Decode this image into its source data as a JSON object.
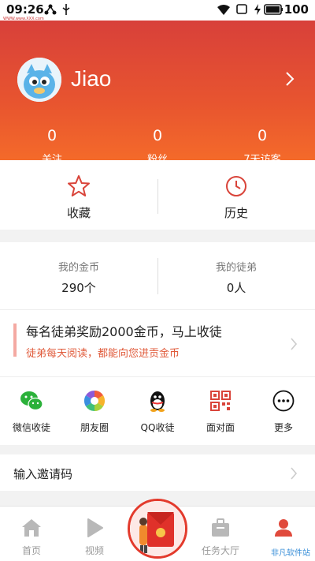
{
  "status_bar": {
    "time": "09:26",
    "battery": "100",
    "tiny_text": "WWW.www.XXX.com"
  },
  "profile": {
    "username": "Jiao"
  },
  "stats": [
    {
      "value": "0",
      "label": "关注"
    },
    {
      "value": "0",
      "label": "粉丝"
    },
    {
      "value": "0",
      "label": "7天访客"
    }
  ],
  "quick": {
    "favorites": "收藏",
    "history": "历史"
  },
  "coins": {
    "my_coins_label": "我的金币",
    "my_coins_value": "290个",
    "apprentices_label": "我的徒弟",
    "apprentices_value": "0人"
  },
  "banner": {
    "title": "每名徒弟奖励2000金币，马上收徒",
    "subtitle": "徒弟每天阅读，都能向您进贡金币"
  },
  "share": [
    {
      "label": "微信收徒",
      "icon": "wechat-icon"
    },
    {
      "label": "朋友圈",
      "icon": "moments-icon"
    },
    {
      "label": "QQ收徒",
      "icon": "qq-icon"
    },
    {
      "label": "面对面",
      "icon": "qr-code-icon"
    },
    {
      "label": "更多",
      "icon": "more-icon"
    }
  ],
  "invite": {
    "label": "输入邀请码"
  },
  "tabs": [
    {
      "label": "首页",
      "icon": "home-icon"
    },
    {
      "label": "视频",
      "icon": "play-icon"
    },
    {
      "label": "",
      "icon": "red-envelope-icon"
    },
    {
      "label": "任务大厅",
      "icon": "briefcase-icon"
    },
    {
      "label": "",
      "icon": "user-icon"
    }
  ],
  "watermark": "非凡软件站",
  "colors": {
    "header_top": "#d8403a",
    "header_bottom": "#f46a2a",
    "accent": "#e04a3c"
  }
}
